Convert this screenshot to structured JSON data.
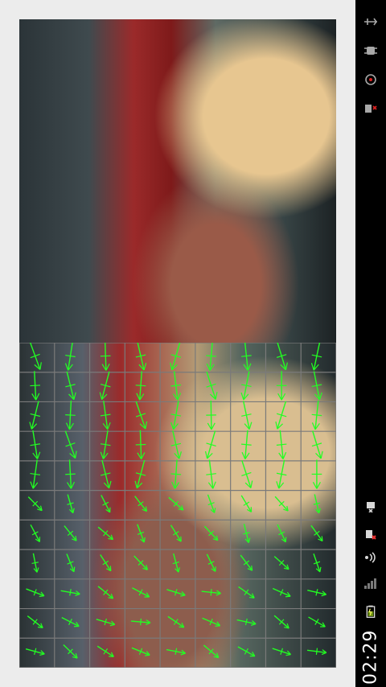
{
  "status_bar": {
    "time": "02:29",
    "icons": [
      "usb-icon",
      "debug-icon",
      "download-icon",
      "sim-error-icon",
      "alarm-icon",
      "no-sim-icon",
      "signal-icon",
      "network-bars-icon",
      "battery-charging-icon"
    ]
  },
  "colors": {
    "flow_vector": "#22ff22",
    "grid_line": "#7a7a7a",
    "statusbar_bg": "#000000",
    "page_bg": "#ececec"
  }
}
